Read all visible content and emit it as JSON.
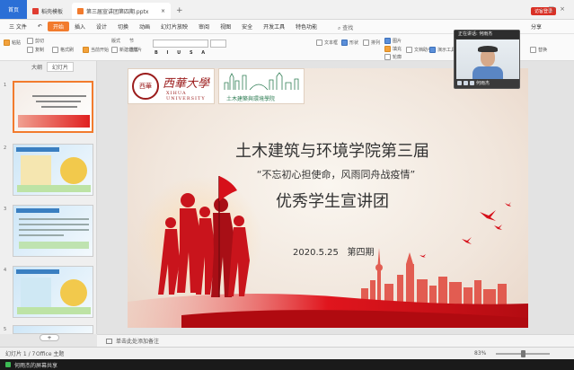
{
  "tabs": {
    "home": "首页",
    "template": "稻壳模板",
    "document": "第三届宣讲团第四期.pptx"
  },
  "window": {
    "login": "访客登录"
  },
  "menu": {
    "file": "三 文件",
    "items": [
      "开始",
      "插入",
      "设计",
      "切换",
      "动画",
      "幻灯片放映",
      "审阅",
      "视图",
      "安全",
      "开发工具",
      "特色功能"
    ],
    "search": "查找",
    "share": "分享"
  },
  "ribbon": {
    "paste": "粘贴",
    "cut": "剪切",
    "copy": "复制",
    "format": "格式刷",
    "current_start": "当前开始",
    "new_slide": "新建幻灯片",
    "layout": "版式",
    "section": "节",
    "reset": "重置",
    "textbox": "文本框",
    "shape": "形状",
    "arrange": "排列",
    "picture": "图片",
    "fill": "填充",
    "outline": "轮廓",
    "doc_helper": "文档助手",
    "presenter": "演示工具",
    "replace": "替换"
  },
  "left_panel": {
    "tab_outline": "大纲",
    "tab_slides": "幻灯片",
    "thumbnails": [
      "1",
      "2",
      "3",
      "4",
      "5"
    ],
    "add": "+"
  },
  "slide": {
    "university_cn": "西華大學",
    "university_en": "XIHUA UNIVERSITY",
    "seal": "西華",
    "college_logo": "土木建築與環境學院",
    "title_line1": "土木建筑与环境学院第三届",
    "title_line2": "“不忘初心担使命，风雨同舟战疫情”",
    "title_line3": "优秀学生宣讲团",
    "date": "2020.5.25",
    "issue": "第四期"
  },
  "notes": {
    "placeholder": "单击此处添加备注"
  },
  "status": {
    "slide_count": "幻灯片 1 / 7",
    "theme": "Office 主题",
    "zoom": "83%"
  },
  "taskbar": {
    "share": "何雨杰的屏幕共享"
  },
  "overlay": {
    "speaker": "正在讲话: 何雨杰",
    "name": "何雨杰"
  },
  "colors": {
    "accent_orange": "#f27b2d",
    "home_blue": "#2b6fd6",
    "brand_red": "#9b1c1c",
    "slide_red": "#d6101a"
  }
}
